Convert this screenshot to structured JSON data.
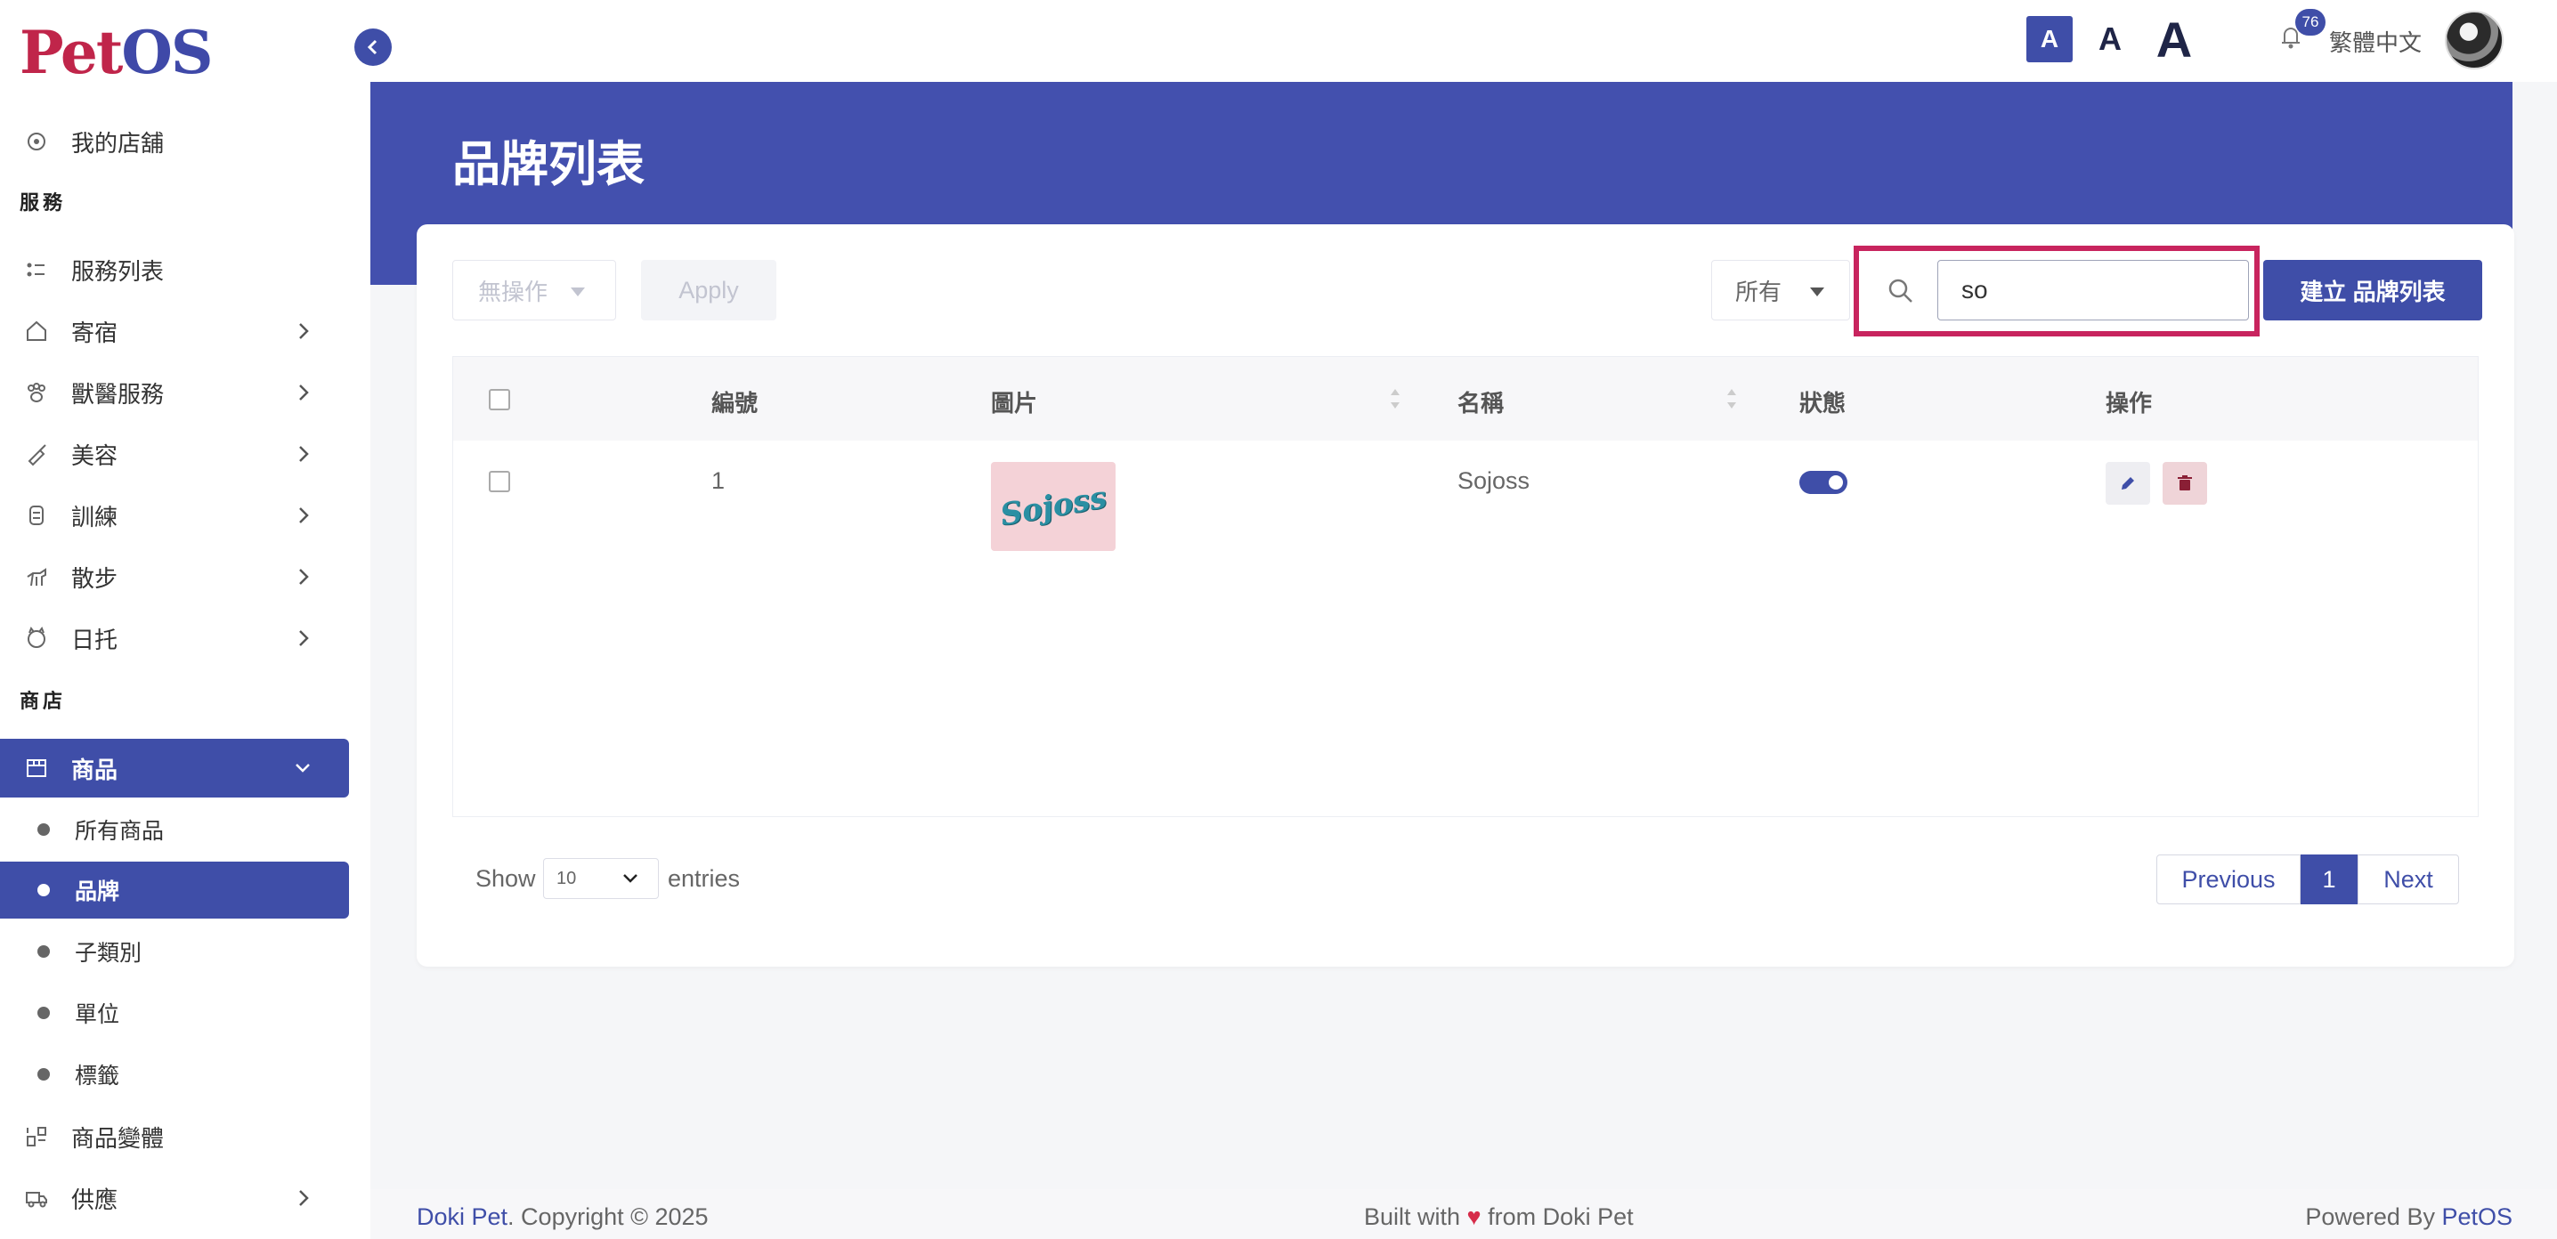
{
  "brand": {
    "logo_part1": "Pet",
    "logo_part2": "OS"
  },
  "sidebar": {
    "my_store": "我的店舖",
    "section_service": "服務",
    "items": [
      {
        "label": "服務列表"
      },
      {
        "label": "寄宿"
      },
      {
        "label": "獸醫服務"
      },
      {
        "label": "美容"
      },
      {
        "label": "訓練"
      },
      {
        "label": "散步"
      },
      {
        "label": "日托"
      }
    ],
    "section_store": "商店",
    "products": {
      "label": "商品"
    },
    "sub_items": [
      {
        "label": "所有商品"
      },
      {
        "label": "品牌"
      },
      {
        "label": "子類別"
      },
      {
        "label": "單位"
      },
      {
        "label": "標籤"
      }
    ],
    "variants": {
      "label": "商品變體"
    },
    "supply": {
      "label": "供應"
    }
  },
  "topbar": {
    "font_small": "A",
    "font_medium": "A",
    "font_large": "A",
    "notification_count": "76",
    "language": "繁體中文"
  },
  "page": {
    "title": "品牌列表"
  },
  "toolbar": {
    "bulk_action": "無操作",
    "apply": "Apply",
    "filter": "所有",
    "search_value": "so",
    "create": "建立 品牌列表"
  },
  "table": {
    "headers": {
      "id": "編號",
      "image": "圖片",
      "name": "名稱",
      "status": "狀態",
      "actions": "操作"
    },
    "rows": [
      {
        "id": "1",
        "image_text": "Sojoss",
        "name": "Sojoss",
        "status": true
      }
    ]
  },
  "pagination": {
    "show": "Show",
    "entries_value": "10",
    "entries": "entries",
    "previous": "Previous",
    "page": "1",
    "next": "Next"
  },
  "footer": {
    "left_brand": "Doki Pet",
    "left_text": ". Copyright © 2025",
    "mid_pre": "Built with ",
    "mid_heart": "♥",
    "mid_post": " from Doki Pet",
    "right_pre": "Powered By ",
    "right_brand": "PetOS"
  },
  "colors": {
    "primary": "#3f4ea8",
    "logo_red": "#c0254a",
    "highlight": "#c8245e"
  }
}
